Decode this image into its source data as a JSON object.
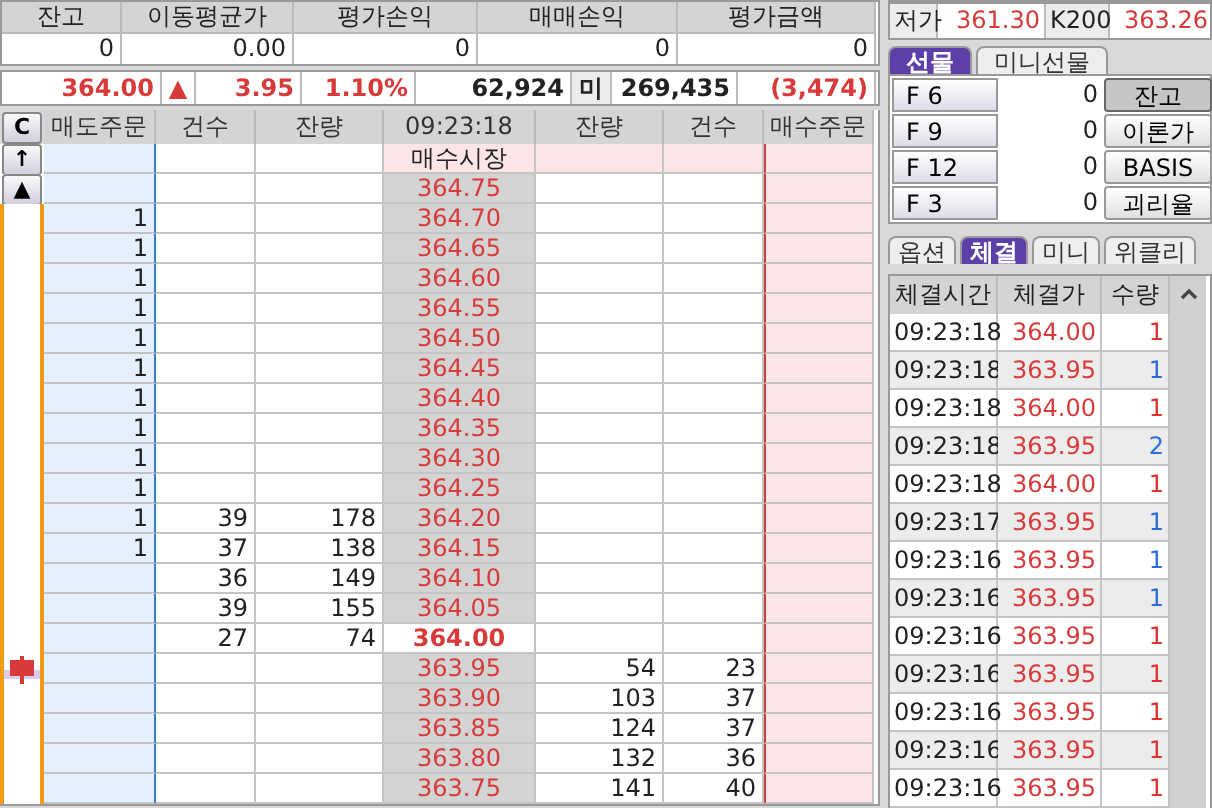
{
  "position": {
    "columns": [
      "잔고",
      "이동평균가",
      "평가손익",
      "매매손익",
      "평가금액"
    ],
    "values": [
      "0",
      "0.00",
      "0",
      "0",
      "0"
    ]
  },
  "quote": {
    "price": "364.00",
    "arrow": "▲",
    "change": "3.95",
    "rate": "1.10%",
    "volume": "62,924",
    "label": "미",
    "open_interest": "269,435",
    "diff": "(3,474)"
  },
  "orderbook": {
    "clear_button": "C",
    "side_buttons": [
      "↑",
      "▲"
    ],
    "columns": [
      "매도주문",
      "건수",
      "잔량",
      "09:23:18",
      "잔량",
      "건수",
      "매수주문"
    ],
    "rows": [
      {
        "kind": "market",
        "price": "매수시장",
        "sell_order": "",
        "sell_count": "",
        "sell_qty": "",
        "buy_qty": "",
        "buy_count": "",
        "current": false,
        "marker": false
      },
      {
        "kind": "level",
        "price": "364.75",
        "sell_order": "",
        "sell_count": "",
        "sell_qty": "",
        "buy_qty": "",
        "buy_count": "",
        "current": false,
        "marker": false
      },
      {
        "kind": "level",
        "price": "364.70",
        "sell_order": "1",
        "sell_count": "",
        "sell_qty": "",
        "buy_qty": "",
        "buy_count": "",
        "current": false,
        "marker": false
      },
      {
        "kind": "level",
        "price": "364.65",
        "sell_order": "1",
        "sell_count": "",
        "sell_qty": "",
        "buy_qty": "",
        "buy_count": "",
        "current": false,
        "marker": false
      },
      {
        "kind": "level",
        "price": "364.60",
        "sell_order": "1",
        "sell_count": "",
        "sell_qty": "",
        "buy_qty": "",
        "buy_count": "",
        "current": false,
        "marker": false
      },
      {
        "kind": "level",
        "price": "364.55",
        "sell_order": "1",
        "sell_count": "",
        "sell_qty": "",
        "buy_qty": "",
        "buy_count": "",
        "current": false,
        "marker": false
      },
      {
        "kind": "level",
        "price": "364.50",
        "sell_order": "1",
        "sell_count": "",
        "sell_qty": "",
        "buy_qty": "",
        "buy_count": "",
        "current": false,
        "marker": false
      },
      {
        "kind": "level",
        "price": "364.45",
        "sell_order": "1",
        "sell_count": "",
        "sell_qty": "",
        "buy_qty": "",
        "buy_count": "",
        "current": false,
        "marker": false
      },
      {
        "kind": "level",
        "price": "364.40",
        "sell_order": "1",
        "sell_count": "",
        "sell_qty": "",
        "buy_qty": "",
        "buy_count": "",
        "current": false,
        "marker": false
      },
      {
        "kind": "level",
        "price": "364.35",
        "sell_order": "1",
        "sell_count": "",
        "sell_qty": "",
        "buy_qty": "",
        "buy_count": "",
        "current": false,
        "marker": false
      },
      {
        "kind": "level",
        "price": "364.30",
        "sell_order": "1",
        "sell_count": "",
        "sell_qty": "",
        "buy_qty": "",
        "buy_count": "",
        "current": false,
        "marker": false
      },
      {
        "kind": "level",
        "price": "364.25",
        "sell_order": "1",
        "sell_count": "",
        "sell_qty": "",
        "buy_qty": "",
        "buy_count": "",
        "current": false,
        "marker": false
      },
      {
        "kind": "level",
        "price": "364.20",
        "sell_order": "1",
        "sell_count": "39",
        "sell_qty": "178",
        "buy_qty": "",
        "buy_count": "",
        "current": false,
        "marker": false
      },
      {
        "kind": "level",
        "price": "364.15",
        "sell_order": "1",
        "sell_count": "37",
        "sell_qty": "138",
        "buy_qty": "",
        "buy_count": "",
        "current": false,
        "marker": false
      },
      {
        "kind": "level",
        "price": "364.10",
        "sell_order": "",
        "sell_count": "36",
        "sell_qty": "149",
        "buy_qty": "",
        "buy_count": "",
        "current": false,
        "marker": false
      },
      {
        "kind": "level",
        "price": "364.05",
        "sell_order": "",
        "sell_count": "39",
        "sell_qty": "155",
        "buy_qty": "",
        "buy_count": "",
        "current": false,
        "marker": false
      },
      {
        "kind": "level",
        "price": "364.00",
        "sell_order": "",
        "sell_count": "27",
        "sell_qty": "74",
        "buy_qty": "",
        "buy_count": "",
        "current": true,
        "marker": false
      },
      {
        "kind": "level",
        "price": "363.95",
        "sell_order": "",
        "sell_count": "",
        "sell_qty": "",
        "buy_qty": "54",
        "buy_count": "23",
        "current": false,
        "marker": true
      },
      {
        "kind": "level",
        "price": "363.90",
        "sell_order": "",
        "sell_count": "",
        "sell_qty": "",
        "buy_qty": "103",
        "buy_count": "37",
        "current": false,
        "marker": false
      },
      {
        "kind": "level",
        "price": "363.85",
        "sell_order": "",
        "sell_count": "",
        "sell_qty": "",
        "buy_qty": "124",
        "buy_count": "37",
        "current": false,
        "marker": false
      },
      {
        "kind": "level",
        "price": "363.80",
        "sell_order": "",
        "sell_count": "",
        "sell_qty": "",
        "buy_qty": "132",
        "buy_count": "36",
        "current": false,
        "marker": false
      },
      {
        "kind": "level",
        "price": "363.75",
        "sell_order": "",
        "sell_count": "",
        "sell_qty": "",
        "buy_qty": "141",
        "buy_count": "40",
        "current": false,
        "marker": false
      }
    ]
  },
  "low_row": {
    "label": "저가",
    "value": "361.30",
    "index_label": "K200",
    "index_value": "363.26"
  },
  "futures_tabs": [
    {
      "label": "선물",
      "selected": true
    },
    {
      "label": "미니선물",
      "selected": false
    }
  ],
  "futures_rows": [
    {
      "code": "F 6",
      "value": "0",
      "action": "잔고",
      "pressed": true
    },
    {
      "code": "F 9",
      "value": "0",
      "action": "이론가",
      "pressed": false
    },
    {
      "code": "F 12",
      "value": "0",
      "action": "BASIS",
      "pressed": false
    },
    {
      "code": "F 3",
      "value": "0",
      "action": "괴리율",
      "pressed": false
    }
  ],
  "trade_tabs": [
    {
      "label": "옵션",
      "selected": false
    },
    {
      "label": "체결",
      "selected": true
    },
    {
      "label": "미니",
      "selected": false
    },
    {
      "label": "위클리",
      "selected": false
    }
  ],
  "trades": {
    "columns": [
      "체결시간",
      "체결가",
      "수량"
    ],
    "rows": [
      {
        "time": "09:23:18",
        "price": "364.00",
        "qty": "1",
        "color": "#e03030"
      },
      {
        "time": "09:23:18",
        "price": "363.95",
        "qty": "1",
        "color": "#2a6fd8"
      },
      {
        "time": "09:23:18",
        "price": "364.00",
        "qty": "1",
        "color": "#e03030"
      },
      {
        "time": "09:23:18",
        "price": "363.95",
        "qty": "2",
        "color": "#2a6fd8"
      },
      {
        "time": "09:23:18",
        "price": "364.00",
        "qty": "1",
        "color": "#e03030"
      },
      {
        "time": "09:23:17",
        "price": "363.95",
        "qty": "1",
        "color": "#2a6fd8"
      },
      {
        "time": "09:23:16",
        "price": "363.95",
        "qty": "1",
        "color": "#2a6fd8"
      },
      {
        "time": "09:23:16",
        "price": "363.95",
        "qty": "1",
        "color": "#2a6fd8"
      },
      {
        "time": "09:23:16",
        "price": "363.95",
        "qty": "1",
        "color": "#e03030"
      },
      {
        "time": "09:23:16",
        "price": "363.95",
        "qty": "1",
        "color": "#e03030"
      },
      {
        "time": "09:23:16",
        "price": "363.95",
        "qty": "1",
        "color": "#e03030"
      },
      {
        "time": "09:23:16",
        "price": "363.95",
        "qty": "1",
        "color": "#e03030"
      },
      {
        "time": "09:23:16",
        "price": "363.95",
        "qty": "1",
        "color": "#e03030"
      }
    ]
  }
}
